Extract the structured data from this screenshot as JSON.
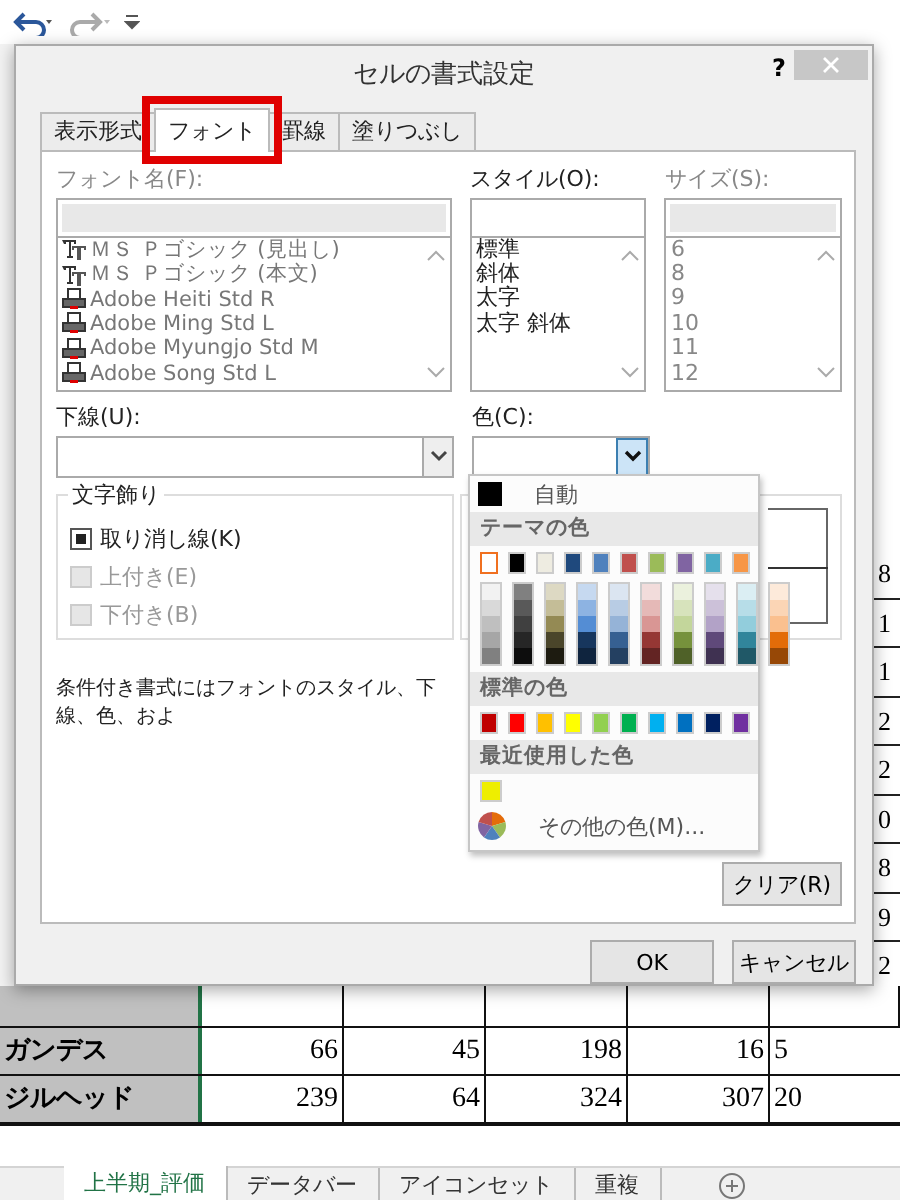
{
  "dialog": {
    "title": "セルの書式設定",
    "help": "?",
    "tabs": [
      {
        "label": "表示形式",
        "selected": false,
        "highlighted": false
      },
      {
        "label": "フォント",
        "selected": true,
        "highlighted": true
      },
      {
        "label": "罫線",
        "selected": false,
        "highlighted": false
      },
      {
        "label": "塗りつぶし",
        "selected": false,
        "highlighted": false
      }
    ],
    "font_name": {
      "label": "フォント名(F):",
      "items": [
        {
          "text": "ＭＳ Ｐゴシック (見出し)",
          "kind": "truetype"
        },
        {
          "text": "ＭＳ Ｐゴシック (本文)",
          "kind": "truetype"
        },
        {
          "text": "Adobe Heiti Std R",
          "kind": "printer"
        },
        {
          "text": "Adobe Ming Std L",
          "kind": "printer"
        },
        {
          "text": "Adobe Myungjo Std M",
          "kind": "printer"
        },
        {
          "text": "Adobe Song Std L",
          "kind": "printer"
        }
      ]
    },
    "style": {
      "label": "スタイル(O):",
      "items": [
        "標準",
        "斜体",
        "太字",
        "太字 斜体"
      ]
    },
    "size": {
      "label": "サイズ(S):",
      "items": [
        "6",
        "8",
        "9",
        "10",
        "11",
        "12"
      ]
    },
    "underline": {
      "label": "下線(U):"
    },
    "color": {
      "label": "色(C):",
      "expanded": true
    },
    "effects": {
      "title": "文字飾り",
      "options": [
        {
          "label": "取り消し線(K)",
          "checked": true,
          "disabled": false
        },
        {
          "label": "上付き(E)",
          "checked": false,
          "disabled": true
        },
        {
          "label": "下付き(B)",
          "checked": false,
          "disabled": true
        }
      ]
    },
    "note": "条件付き書式にはフォントのスタイル、下線、色、およ",
    "clear_button": "クリア(R)",
    "buttons": [
      "OK",
      "キャンセル"
    ]
  },
  "color_menu": {
    "automatic": "自動",
    "theme_title": "テーマの色",
    "theme": [
      {
        "color": "#ffffff",
        "selected": true,
        "shades": [
          {
            "color": "#f2f2f2",
            "selected": false
          },
          {
            "color": "#d9d9d9",
            "selected": false
          },
          {
            "color": "#bfbfbf",
            "selected": false
          },
          {
            "color": "#a6a6a6",
            "selected": false
          },
          {
            "color": "#808080",
            "selected": false
          }
        ]
      },
      {
        "color": "#000000",
        "selected": false,
        "shades": [
          {
            "color": "#808080",
            "selected": false
          },
          {
            "color": "#595959",
            "selected": false
          },
          {
            "color": "#404040",
            "selected": false
          },
          {
            "color": "#262626",
            "selected": false
          },
          {
            "color": "#0d0d0d",
            "selected": false
          }
        ]
      },
      {
        "color": "#eeece1",
        "selected": false,
        "shades": [
          {
            "color": "#ddd9c3",
            "selected": false
          },
          {
            "color": "#c4bd97",
            "selected": false
          },
          {
            "color": "#948a54",
            "selected": false
          },
          {
            "color": "#4a452a",
            "selected": false
          },
          {
            "color": "#1d1b10",
            "selected": false
          }
        ]
      },
      {
        "color": "#1f497d",
        "selected": false,
        "shades": [
          {
            "color": "#c6d9f0",
            "selected": false
          },
          {
            "color": "#8db3e2",
            "selected": false
          },
          {
            "color": "#548dd4",
            "selected": false
          },
          {
            "color": "#17365d",
            "selected": false
          },
          {
            "color": "#0f243e",
            "selected": false
          }
        ]
      },
      {
        "color": "#4f81bd",
        "selected": false,
        "shades": [
          {
            "color": "#dbe5f1",
            "selected": false
          },
          {
            "color": "#b8cce4",
            "selected": false
          },
          {
            "color": "#95b3d7",
            "selected": false
          },
          {
            "color": "#366092",
            "selected": false
          },
          {
            "color": "#244061",
            "selected": false
          }
        ]
      },
      {
        "color": "#c0504d",
        "selected": false,
        "shades": [
          {
            "color": "#f2dcdb",
            "selected": false
          },
          {
            "color": "#e5b9b7",
            "selected": false
          },
          {
            "color": "#d99694",
            "selected": false
          },
          {
            "color": "#953734",
            "selected": false
          },
          {
            "color": "#632423",
            "selected": false
          }
        ]
      },
      {
        "color": "#9bbb59",
        "selected": false,
        "shades": [
          {
            "color": "#ebf1dd",
            "selected": false
          },
          {
            "color": "#d7e3bc",
            "selected": false
          },
          {
            "color": "#c3d69b",
            "selected": false
          },
          {
            "color": "#76923c",
            "selected": false
          },
          {
            "color": "#4f6128",
            "selected": false
          }
        ]
      },
      {
        "color": "#8064a2",
        "selected": false,
        "shades": [
          {
            "color": "#e5e0ec",
            "selected": false
          },
          {
            "color": "#ccc1d9",
            "selected": false
          },
          {
            "color": "#b2a2c7",
            "selected": false
          },
          {
            "color": "#5f497a",
            "selected": false
          },
          {
            "color": "#3f3151",
            "selected": false
          }
        ]
      },
      {
        "color": "#4bacc6",
        "selected": false,
        "shades": [
          {
            "color": "#dbeef3",
            "selected": false
          },
          {
            "color": "#b7dde8",
            "selected": false
          },
          {
            "color": "#92cddc",
            "selected": false
          },
          {
            "color": "#31859b",
            "selected": false
          },
          {
            "color": "#205867",
            "selected": false
          }
        ]
      },
      {
        "color": "#f79646",
        "selected": false,
        "shades": [
          {
            "color": "#fdeada",
            "selected": false
          },
          {
            "color": "#fbd5b5",
            "selected": false
          },
          {
            "color": "#fac08f",
            "selected": false
          },
          {
            "color": "#e36c09",
            "selected": false
          },
          {
            "color": "#974806",
            "selected": false
          }
        ]
      }
    ],
    "standard_title": "標準の色",
    "standard": [
      {
        "color": "#c00000",
        "selected": false
      },
      {
        "color": "#ff0000",
        "selected": false
      },
      {
        "color": "#ffc000",
        "selected": false
      },
      {
        "color": "#ffff00",
        "selected": false
      },
      {
        "color": "#92d050",
        "selected": false
      },
      {
        "color": "#00b050",
        "selected": false
      },
      {
        "color": "#00b0f0",
        "selected": false
      },
      {
        "color": "#0070c0",
        "selected": false
      },
      {
        "color": "#002060",
        "selected": false
      },
      {
        "color": "#7030a0",
        "selected": false
      }
    ],
    "recent_title": "最近使用した色",
    "recent": [
      {
        "color": "#eeee00",
        "selected": false
      }
    ],
    "more_colors": "その他の色(M)..."
  },
  "sheet": {
    "right_column": [
      "8",
      "1",
      "1",
      "2",
      "2",
      "0",
      "8",
      "9",
      "2"
    ],
    "rows": [
      {
        "name": "ガンデス",
        "values": [
          "66",
          "45",
          "198",
          "16",
          "5"
        ]
      },
      {
        "name": "ジルヘッド",
        "values": [
          "239",
          "64",
          "324",
          "307",
          "20"
        ]
      }
    ]
  },
  "sheet_tabs": [
    {
      "label": "上半期_評価",
      "selected": true
    },
    {
      "label": "データバー",
      "selected": false
    },
    {
      "label": "アイコンセット",
      "selected": false
    },
    {
      "label": "重複",
      "selected": false
    }
  ]
}
